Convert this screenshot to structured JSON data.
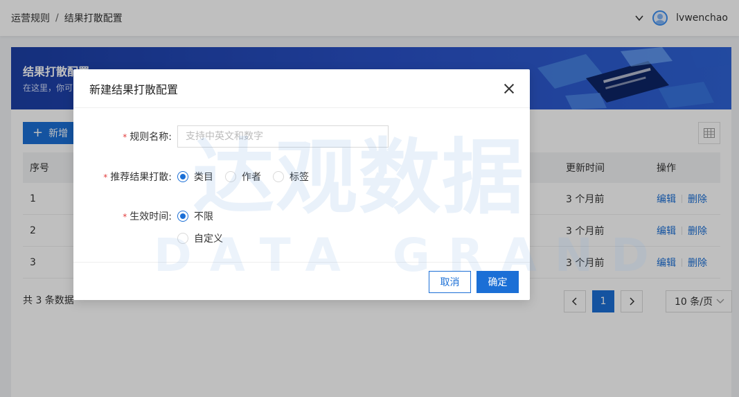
{
  "breadcrumb": {
    "items": [
      "运营规则",
      "结果打散配置"
    ],
    "separator": "/"
  },
  "user": {
    "name": "lvwenchao",
    "dropdown_icon": "chevron-down-icon",
    "avatar_icon": "user-avatar-icon"
  },
  "banner": {
    "title": "结果打散配置",
    "description": "在这里，你可"
  },
  "toolbar": {
    "add_label": "新增",
    "add_icon": "plus-icon",
    "columns_icon": "table-columns-icon"
  },
  "table": {
    "headers": {
      "index": "序号",
      "updated": "更新时间",
      "ops": "操作"
    },
    "rows": [
      {
        "index": "1",
        "updated": "3 个月前",
        "edit": "编辑",
        "delete": "删除"
      },
      {
        "index": "2",
        "updated": "3 个月前",
        "edit": "编辑",
        "delete": "删除"
      },
      {
        "index": "3",
        "updated": "3 个月前",
        "edit": "编辑",
        "delete": "删除"
      }
    ]
  },
  "footer": {
    "total": "共 3 条数据",
    "prev_icon": "chevron-left-icon",
    "next_icon": "chevron-right-icon",
    "current_page": "1",
    "page_size": "10 条/页"
  },
  "modal": {
    "title": "新建结果打散配置",
    "rule_name": {
      "label": "规则名称:",
      "value": "",
      "placeholder": "支持中英文和数字"
    },
    "scatter": {
      "label": "推荐结果打散:",
      "options": [
        "类目",
        "作者",
        "标签"
      ],
      "selected": "类目"
    },
    "effective": {
      "label": "生效时间:",
      "options": [
        "不限",
        "自定义"
      ],
      "selected": "不限"
    },
    "cancel_label": "取消",
    "ok_label": "确定"
  },
  "watermark": {
    "cn": "达观数据",
    "en": "DATA GRAND"
  },
  "colors": {
    "primary": "#1b6fd6",
    "banner": "#2a52c9",
    "required": "#e23d3d"
  }
}
